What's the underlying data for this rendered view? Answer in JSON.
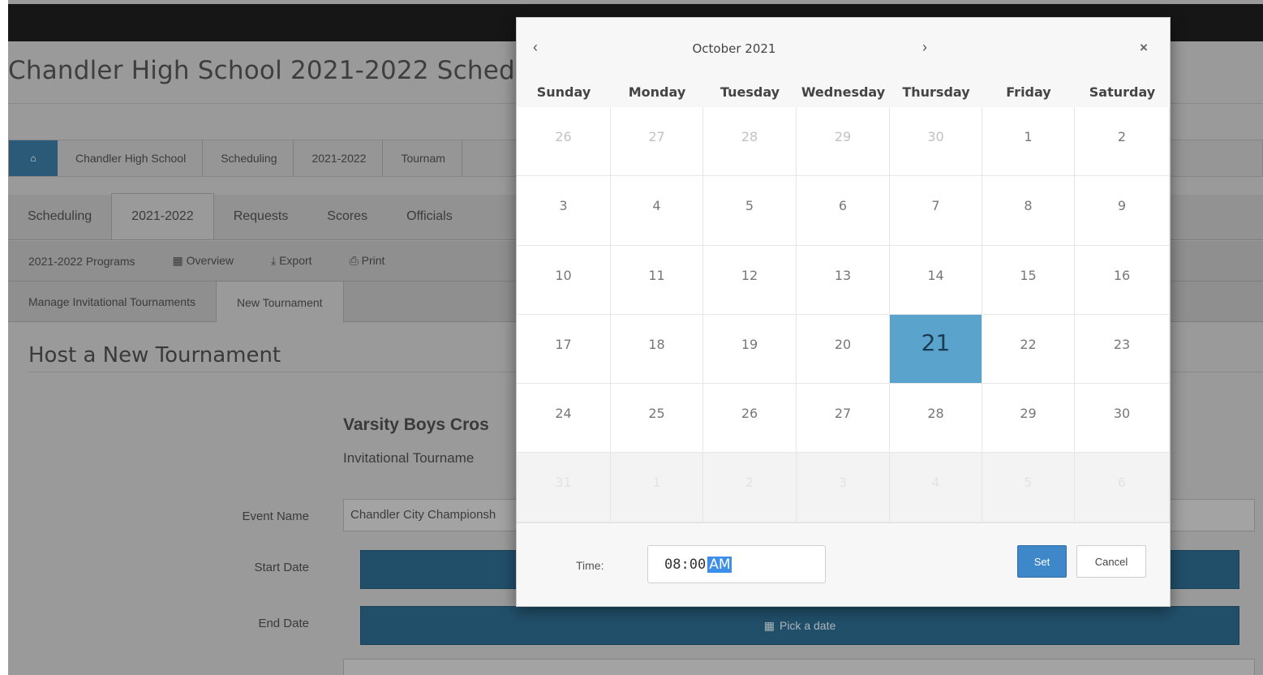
{
  "page": {
    "title": "Chandler High School 2021-2022 Schedu",
    "breadcrumb": [
      "Chandler High School",
      "Scheduling",
      "2021-2022",
      "Tournam"
    ],
    "tabs": [
      "Scheduling",
      "2021-2022",
      "Requests",
      "Scores",
      "Officials"
    ],
    "active_tab": "2021-2022",
    "subnav": [
      "2021-2022 Programs",
      "Overview",
      "Export",
      "Print"
    ],
    "tournament_tabs": [
      "Manage Invitational Tournaments",
      "New Tournament"
    ],
    "section_title": "Host a New Tournament",
    "event_heading": "Varsity Boys Cros",
    "event_subheading": "Invitational Tourname",
    "form": {
      "event_name_label": "Event Name",
      "event_name_value": "Chandler City Championsh",
      "start_date_label": "Start Date",
      "end_date_label": "End Date",
      "pick_date_label": "Pick a date"
    }
  },
  "datepicker": {
    "month_label": "October 2021",
    "prev_glyph": "‹",
    "next_glyph": "›",
    "close_glyph": "×",
    "weekdays": [
      "Sunday",
      "Monday",
      "Tuesday",
      "Wednesday",
      "Thursday",
      "Friday",
      "Saturday"
    ],
    "weeks": [
      [
        "26",
        "27",
        "28",
        "29",
        "30",
        "1",
        "2"
      ],
      [
        "3",
        "4",
        "5",
        "6",
        "7",
        "8",
        "9"
      ],
      [
        "10",
        "11",
        "12",
        "13",
        "14",
        "15",
        "16"
      ],
      [
        "17",
        "18",
        "19",
        "20",
        "21",
        "22",
        "23"
      ],
      [
        "24",
        "25",
        "26",
        "27",
        "28",
        "29",
        "30"
      ],
      [
        "31",
        "1",
        "2",
        "3",
        "4",
        "5",
        "6"
      ]
    ],
    "selected_day": "21",
    "time_label": "Time:",
    "time_value": "08:00",
    "time_ampm": "AM",
    "set_label": "Set",
    "cancel_label": "Cancel",
    "selected_color": "#5aa3cc",
    "set_color": "#3e87c8"
  }
}
